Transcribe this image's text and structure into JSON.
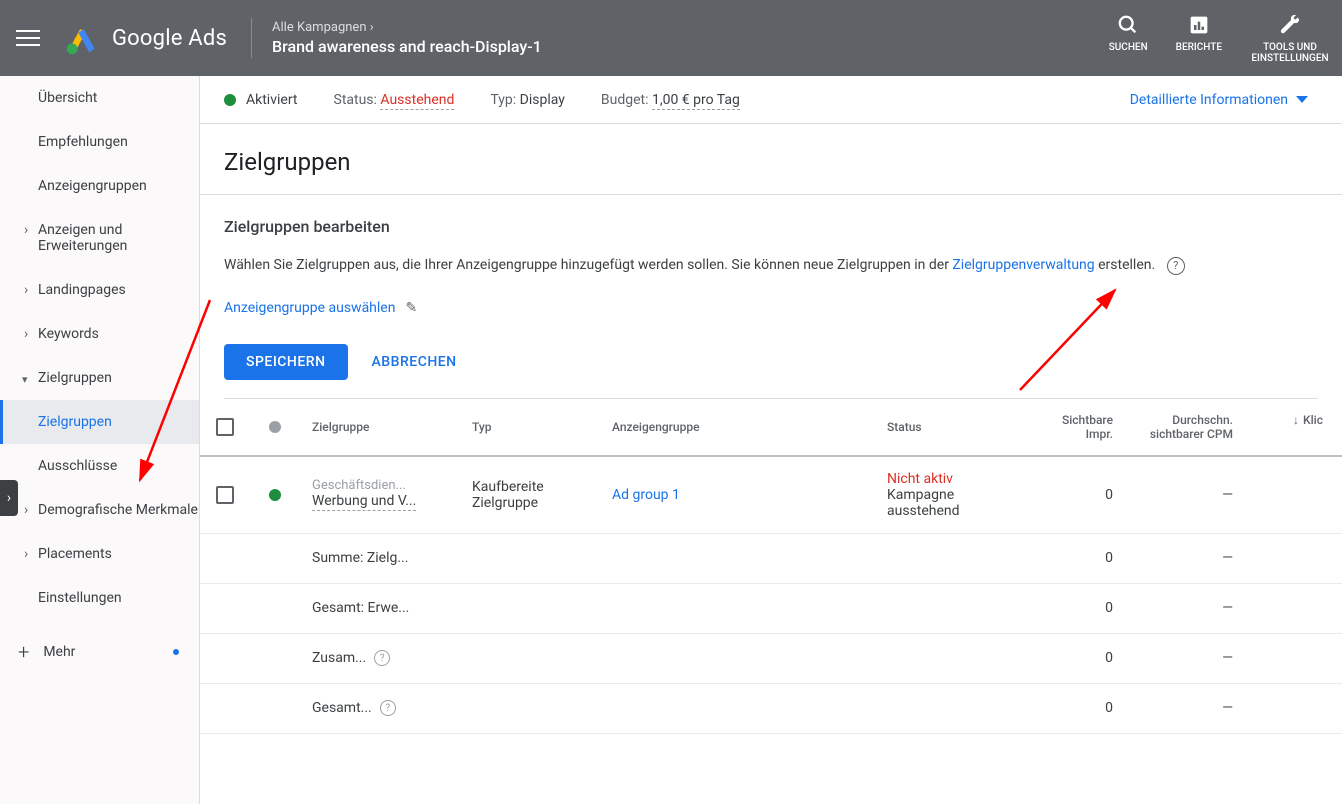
{
  "header": {
    "logo_text": "Google Ads",
    "breadcrumb_top": "Alle Kampagnen",
    "breadcrumb_bottom": "Brand awareness and reach-Display-1",
    "search_label": "SUCHEN",
    "reports_label": "BERICHTE",
    "tools_label": "TOOLS UND EINSTELLUNGEN"
  },
  "statusbar": {
    "activated": "Aktiviert",
    "status_label": "Status:",
    "status_value": "Ausstehend",
    "type_label": "Typ:",
    "type_value": "Display",
    "budget_label": "Budget:",
    "budget_value": "1,00 € pro Tag",
    "detail_link": "Detaillierte Informationen"
  },
  "sidebar": {
    "items": [
      {
        "label": "Übersicht"
      },
      {
        "label": "Empfehlungen"
      },
      {
        "label": "Anzeigengruppen"
      },
      {
        "label": "Anzeigen und Erweiterungen",
        "caret": true
      },
      {
        "label": "Landingpages",
        "caret": true
      },
      {
        "label": "Keywords",
        "caret": true
      },
      {
        "label": "Zielgruppen",
        "caret_down": true
      },
      {
        "label": "Demografische Merkmale",
        "caret": true
      },
      {
        "label": "Placements",
        "caret": true
      },
      {
        "label": "Einstellungen"
      }
    ],
    "sub_zielgruppen": "Zielgruppen",
    "sub_ausschluesse": "Ausschlüsse",
    "mehr": "Mehr"
  },
  "page": {
    "title": "Zielgruppen",
    "section_title": "Zielgruppen bearbeiten",
    "desc_part1": "Wählen Sie Zielgruppen aus, die Ihrer Anzeigengruppe hinzugefügt werden sollen. Sie können neue Zielgruppen in der ",
    "desc_link": "Zielgruppenverwaltung",
    "desc_part2": " erstellen.",
    "select_group": "Anzeigengruppe auswählen",
    "save": "SPEICHERN",
    "cancel": "ABBRECHEN"
  },
  "table": {
    "headers": {
      "zielgruppe": "Zielgruppe",
      "typ": "Typ",
      "anzeigengruppe": "Anzeigengruppe",
      "status": "Status",
      "impr": "Sichtbare Impr.",
      "cpm": "Durchschn. sichtbarer CPM",
      "klicks": "Klic"
    },
    "row1": {
      "muted": "Geschäftsdien...",
      "name": "Werbung und V...",
      "typ": "Kaufbereite Zielgruppe",
      "ag": "Ad group 1",
      "status_red": "Nicht aktiv",
      "status_sub": "Kampagne ausstehend",
      "impr": "0",
      "cpm": "—"
    },
    "summaries": [
      {
        "label": "Summe: Zielg...",
        "impr": "0",
        "cpm": "—"
      },
      {
        "label": "Gesamt: Erwe...",
        "impr": "0",
        "cpm": "—"
      },
      {
        "label": "Zusam...",
        "impr": "0",
        "cpm": "—",
        "info": true
      },
      {
        "label": "Gesamt...",
        "impr": "0",
        "cpm": "—",
        "info": true
      }
    ]
  }
}
